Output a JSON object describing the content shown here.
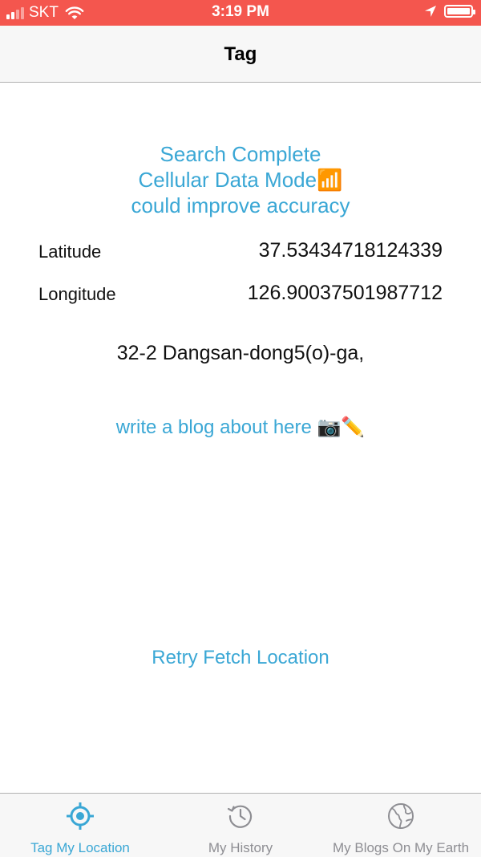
{
  "status_bar": {
    "carrier": "SKT",
    "time": "3:19 PM",
    "battery_level": 1.0,
    "signal_bars": 4,
    "signal_bars_active": 2
  },
  "nav": {
    "title": "Tag"
  },
  "main": {
    "status_lines": [
      "Search Complete",
      "Cellular Data Mode📶",
      "could improve accuracy"
    ],
    "latitude_label": "Latitude",
    "latitude_value": "37.53434718124339",
    "longitude_label": "Longitude",
    "longitude_value": "126.90037501987712",
    "address": "32-2 Dangsan-dong5(o)-ga,",
    "blog_link": "write a blog about here 📷✏️",
    "retry_button": "Retry Fetch Location"
  },
  "tabs": [
    {
      "label": "Tag My Location",
      "icon": "crosshair-icon",
      "active": true
    },
    {
      "label": "My History",
      "icon": "history-clock-icon",
      "active": false
    },
    {
      "label": "My Blogs On My Earth",
      "icon": "globe-icon",
      "active": false
    }
  ],
  "colors": {
    "status_bar_bg": "#f4564e",
    "accent": "#3aa7d5",
    "inactive_tab": "#8e8e93"
  }
}
